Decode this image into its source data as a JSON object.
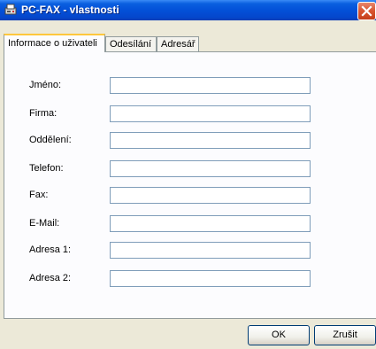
{
  "window": {
    "title": "PC-FAX - vlastnosti"
  },
  "tabs": [
    {
      "label": "Informace o uživateli",
      "active": true
    },
    {
      "label": "Odesílání",
      "active": false
    },
    {
      "label": "Adresář",
      "active": false
    }
  ],
  "form": {
    "fields": [
      {
        "label": "Jméno:",
        "value": ""
      },
      {
        "label": "Firma:",
        "value": ""
      },
      {
        "label": "Oddělení:",
        "value": ""
      },
      {
        "label": "Telefon:",
        "value": ""
      },
      {
        "label": "Fax:",
        "value": ""
      },
      {
        "label": "E-Mail:",
        "value": ""
      },
      {
        "label": "Adresa 1:",
        "value": ""
      },
      {
        "label": "Adresa 2:",
        "value": ""
      }
    ]
  },
  "buttons": {
    "ok_label": "OK",
    "cancel_label": "Zrušit"
  },
  "colors": {
    "titlebar": "#0350d8",
    "close_button": "#d8542f",
    "dialog_background": "#ece9d8",
    "active_tab_accent": "#ffc73c"
  }
}
